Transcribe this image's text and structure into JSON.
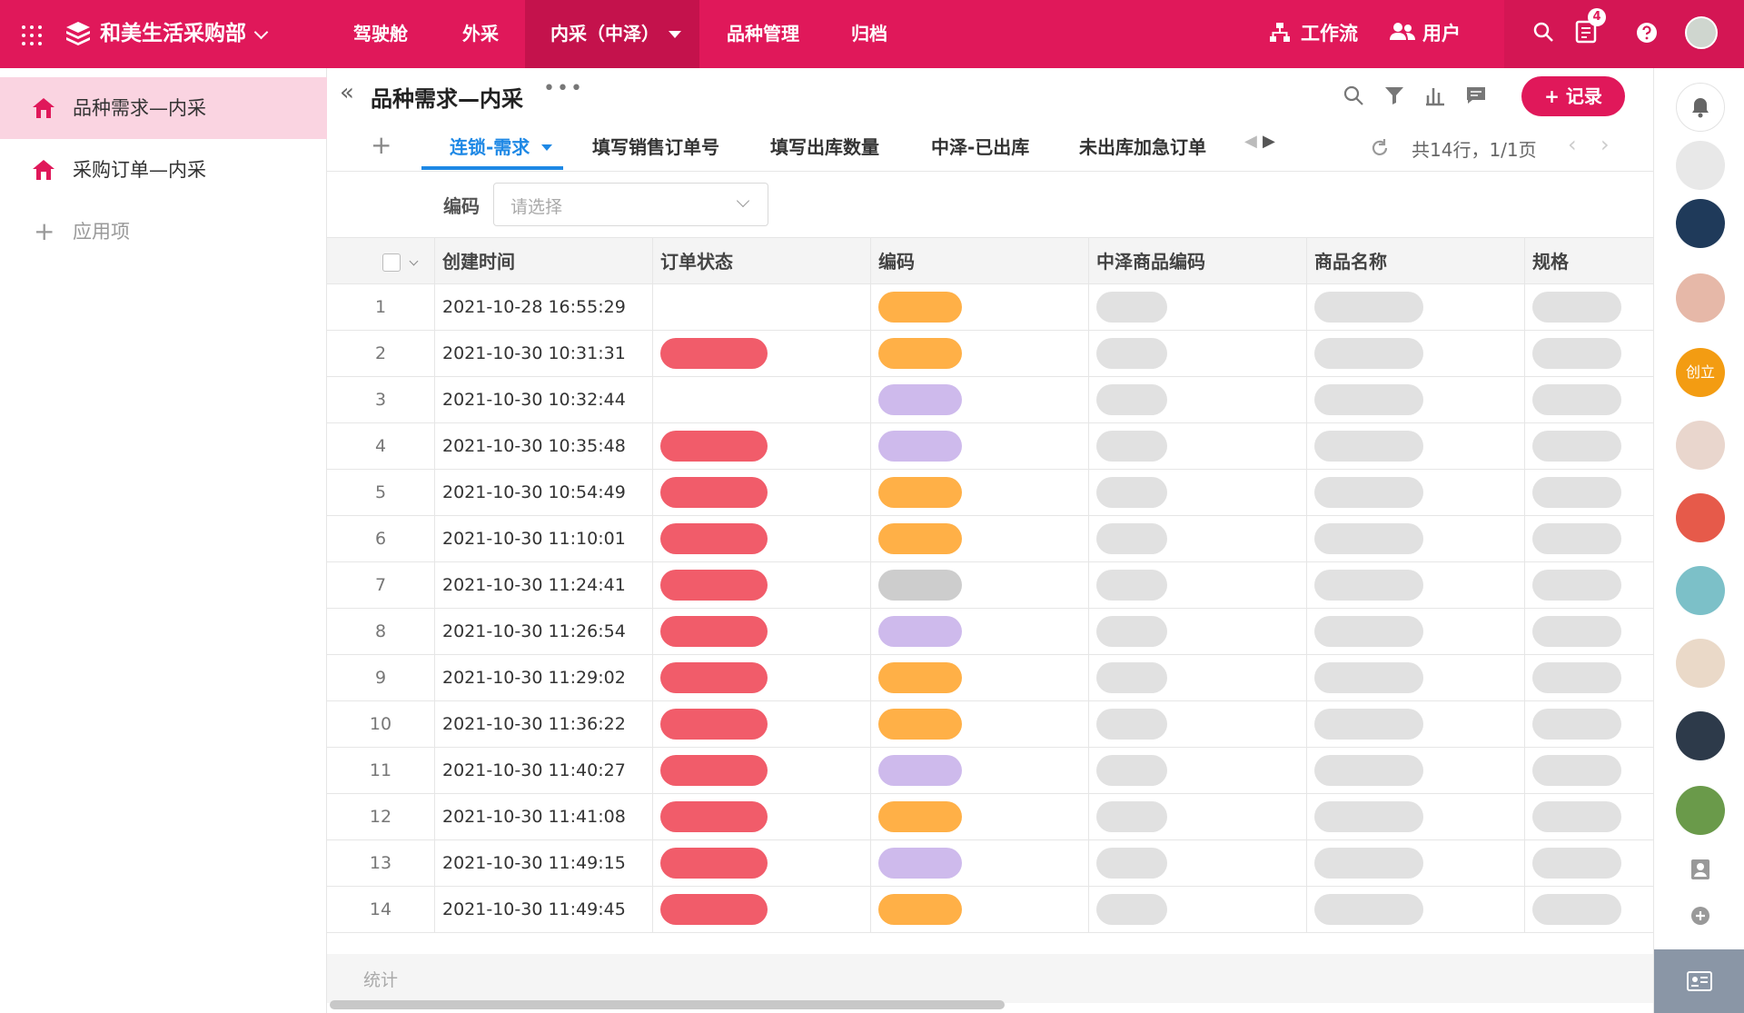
{
  "topbar": {
    "app_name": "和美生活采购部",
    "nav": [
      {
        "label": "驾驶舱"
      },
      {
        "label": "外采"
      },
      {
        "label": "内采（中泽）"
      },
      {
        "label": "品种管理"
      },
      {
        "label": "归档"
      }
    ],
    "workflow_label": "工作流",
    "users_label": "用户",
    "notification_count": "4",
    "accent_color": "#e0185a"
  },
  "sidebar": {
    "items": [
      {
        "label": "品种需求—内采"
      },
      {
        "label": "采购订单—内采"
      }
    ],
    "add_label": "应用项"
  },
  "main": {
    "title": "品种需求—内采",
    "record_button": "记录",
    "tabs": [
      {
        "label": "连锁-需求"
      },
      {
        "label": "填写销售订单号"
      },
      {
        "label": "填写出库数量"
      },
      {
        "label": "中泽-已出库"
      },
      {
        "label": "未出库加急订单"
      }
    ],
    "page_info": "共14行，1/1页",
    "filter": {
      "label": "编码",
      "placeholder": "请选择"
    },
    "columns": [
      "创建时间",
      "订单状态",
      "编码",
      "中泽商品编码",
      "商品名称",
      "规格"
    ],
    "rows": [
      {
        "index": "1",
        "created": "2021-10-28 16:55:29"
      },
      {
        "index": "2",
        "created": "2021-10-30 10:31:31"
      },
      {
        "index": "3",
        "created": "2021-10-30 10:32:44"
      },
      {
        "index": "4",
        "created": "2021-10-30 10:35:48"
      },
      {
        "index": "5",
        "created": "2021-10-30 10:54:49"
      },
      {
        "index": "6",
        "created": "2021-10-30 11:10:01"
      },
      {
        "index": "7",
        "created": "2021-10-30 11:24:41"
      },
      {
        "index": "8",
        "created": "2021-10-30 11:26:54"
      },
      {
        "index": "9",
        "created": "2021-10-30 11:29:02"
      },
      {
        "index": "10",
        "created": "2021-10-30 11:36:22"
      },
      {
        "index": "11",
        "created": "2021-10-30 11:40:27"
      },
      {
        "index": "12",
        "created": "2021-10-30 11:41:08"
      },
      {
        "index": "13",
        "created": "2021-10-30 11:49:15"
      },
      {
        "index": "14",
        "created": "2021-10-30 11:49:45"
      }
    ],
    "stats_label": "统计"
  },
  "right_bar": {
    "org_avatar_label": "创立"
  }
}
